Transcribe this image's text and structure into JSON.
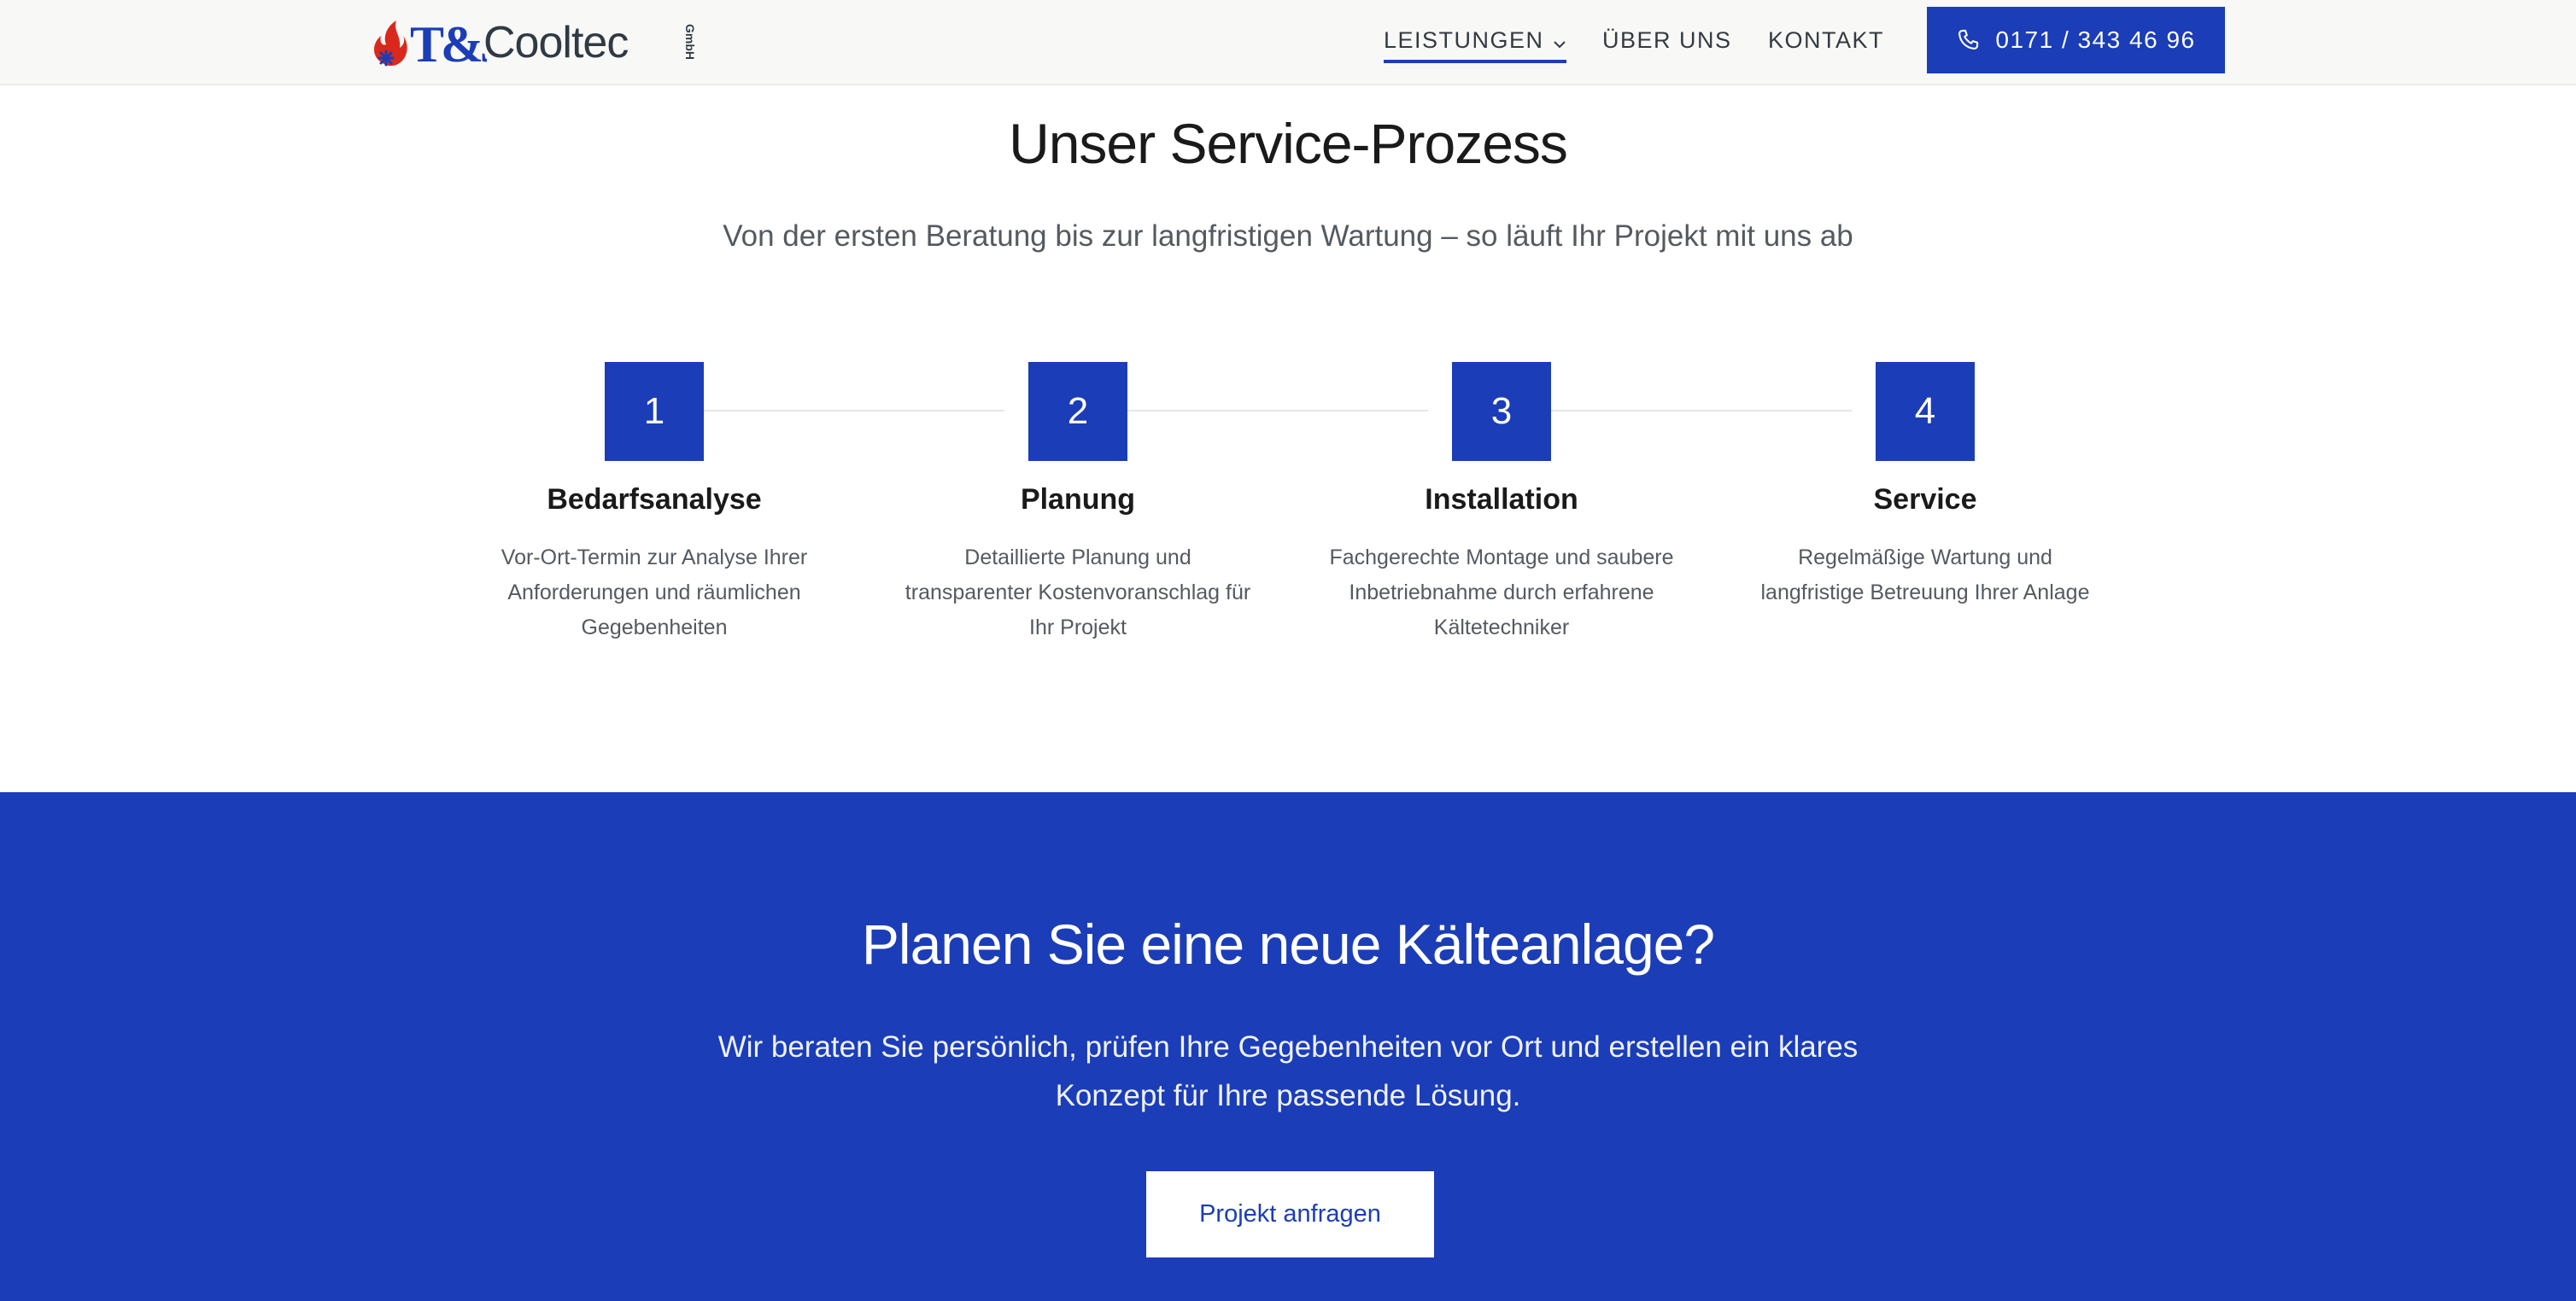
{
  "header": {
    "logo": {
      "mark": "T&J",
      "word": "Cooltec",
      "suffix": "GmbH"
    },
    "nav": [
      {
        "label": "LEISTUNGEN",
        "active": true,
        "has_dropdown": true
      },
      {
        "label": "ÜBER UNS",
        "active": false
      },
      {
        "label": "KONTAKT",
        "active": false
      }
    ],
    "phone_label": "0171 / 343 46 96"
  },
  "process": {
    "title": "Unser Service-Prozess",
    "subtitle": "Von der ersten Beratung bis zur langfristigen Wartung – so läuft Ihr Projekt mit uns ab",
    "steps": [
      {
        "number": "1",
        "title": "Bedarfsanalyse",
        "desc": "Vor-Ort-Termin zur Analyse Ihrer Anforderungen und räumlichen Gegebenheiten"
      },
      {
        "number": "2",
        "title": "Planung",
        "desc": "Detaillierte Planung und transparenter Kostenvoranschlag für Ihr Projekt"
      },
      {
        "number": "3",
        "title": "Installation",
        "desc": "Fachgerechte Montage und saubere Inbetriebnahme durch erfahrene Kältetechniker"
      },
      {
        "number": "4",
        "title": "Service",
        "desc": "Regelmäßige Wartung und langfristige Betreuung Ihrer Anlage"
      }
    ]
  },
  "cta": {
    "title": "Planen Sie eine neue Kälteanlage?",
    "text": "Wir beraten Sie persönlich, prüfen Ihre Gegebenheiten vor Ort und erstellen ein klares Konzept für Ihre passende Lösung.",
    "button_label": "Projekt anfragen"
  },
  "colors": {
    "brand_blue": "#1b3db7",
    "brand_red": "#d9291c",
    "header_bg": "#f8f8f6"
  },
  "icons": {
    "phone": "phone-icon",
    "chevron": "chevron-down-icon",
    "flame": "flame-icon",
    "snowflake": "snowflake-icon"
  }
}
